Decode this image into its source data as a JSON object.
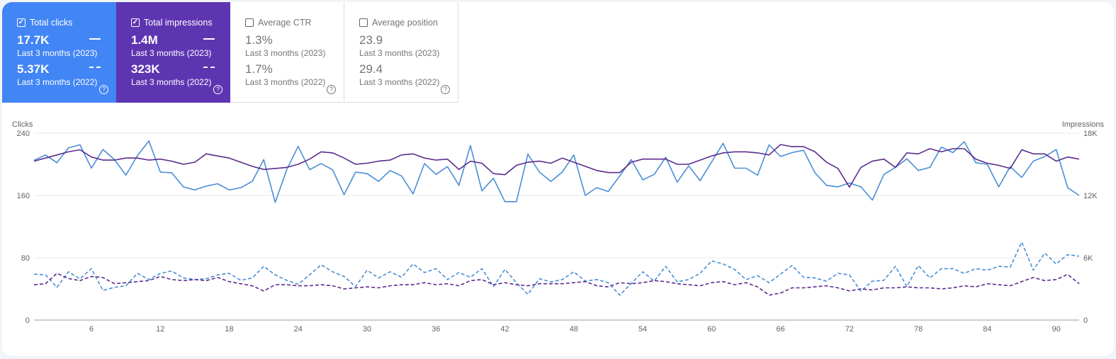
{
  "metrics": [
    {
      "label": "Total clicks",
      "checked": true,
      "value_2023": "17.7K",
      "period_2023": "Last 3 months (2023)",
      "value_2022": "5.37K",
      "period_2022": "Last 3 months (2022)",
      "bg": "#4285f4",
      "fg": "#ffffff"
    },
    {
      "label": "Total impressions",
      "checked": true,
      "value_2023": "1.4M",
      "period_2023": "Last 3 months (2023)",
      "value_2022": "323K",
      "period_2022": "Last 3 months (2022)",
      "bg": "#5e35b1",
      "fg": "#ffffff"
    },
    {
      "label": "Average CTR",
      "checked": false,
      "value_2023": "1.3%",
      "period_2023": "Last 3 months (2023)",
      "value_2022": "1.7%",
      "period_2022": "Last 3 months (2022)",
      "bg": "#ffffff",
      "fg": "#757575"
    },
    {
      "label": "Average position",
      "checked": false,
      "value_2023": "23.9",
      "period_2023": "Last 3 months (2023)",
      "value_2022": "29.4",
      "period_2022": "Last 3 months (2022)",
      "bg": "#ffffff",
      "fg": "#757575"
    }
  ],
  "icons": {
    "checkbox": "checkbox-icon",
    "help": "help-icon"
  },
  "chart_data": {
    "type": "line",
    "ylabel": "Clicks",
    "y2label": "Impressions",
    "ylim": [
      0,
      240
    ],
    "yticks": [
      0,
      80,
      160,
      240
    ],
    "y2lim": [
      0,
      18000
    ],
    "y2ticks": [
      "0",
      "6K",
      "12K",
      "18K"
    ],
    "xlim": [
      1,
      92
    ],
    "xticks": [
      6,
      12,
      18,
      24,
      30,
      36,
      42,
      48,
      54,
      60,
      66,
      72,
      78,
      84,
      90
    ],
    "grid": true,
    "series": [
      {
        "axis": "left",
        "style": "solid",
        "color": "#4a8ed6",
        "values": [
          205,
          212,
          202,
          221,
          225,
          195,
          219,
          206,
          186,
          211,
          230,
          190,
          189,
          171,
          167,
          172,
          175,
          167,
          170,
          178,
          206,
          151,
          193,
          223,
          193,
          201,
          193,
          161,
          190,
          188,
          178,
          192,
          185,
          162,
          201,
          187,
          197,
          173,
          224,
          166,
          182,
          152,
          152,
          213,
          190,
          178,
          190,
          212,
          160,
          170,
          165,
          185,
          206,
          180,
          187,
          209,
          177,
          198,
          179,
          203,
          227,
          195,
          195,
          186,
          225,
          210,
          215,
          218,
          189,
          173,
          171,
          176,
          171,
          154,
          187,
          196,
          207,
          192,
          196,
          222,
          215,
          229,
          202,
          200,
          171,
          197,
          183,
          204,
          210,
          219,
          170,
          160
        ]
      },
      {
        "axis": "right",
        "style": "solid",
        "color": "#5b2c8e",
        "values": [
          15300,
          15600,
          15900,
          16200,
          16400,
          15700,
          15400,
          15400,
          15600,
          15600,
          15400,
          15500,
          15300,
          15000,
          15200,
          16000,
          15800,
          15600,
          15200,
          14800,
          14500,
          14600,
          14700,
          15000,
          15500,
          16200,
          16100,
          15600,
          15000,
          15100,
          15300,
          15400,
          15900,
          16000,
          15600,
          15400,
          15500,
          14500,
          15300,
          15100,
          14100,
          14000,
          14900,
          15200,
          15300,
          15100,
          15600,
          15200,
          14800,
          14400,
          14200,
          14200,
          15200,
          15500,
          15500,
          15500,
          15000,
          15000,
          15400,
          15800,
          16100,
          16200,
          16200,
          16100,
          15900,
          16900,
          16700,
          16700,
          16200,
          15200,
          14600,
          12800,
          14700,
          15300,
          15500,
          14700,
          16100,
          16000,
          16500,
          16200,
          16500,
          16500,
          15500,
          15100,
          14900,
          14600,
          16400,
          16000,
          16000,
          15300,
          15700,
          15500
        ]
      },
      {
        "axis": "left",
        "style": "dashed",
        "color": "#4a8ed6",
        "values": [
          59,
          58,
          42,
          62,
          53,
          66,
          38,
          42,
          44,
          60,
          52,
          60,
          63,
          54,
          52,
          53,
          58,
          60,
          51,
          54,
          69,
          58,
          51,
          46,
          58,
          71,
          62,
          56,
          43,
          64,
          54,
          62,
          55,
          72,
          61,
          66,
          52,
          61,
          55,
          66,
          43,
          65,
          48,
          33,
          53,
          49,
          52,
          62,
          50,
          52,
          48,
          32,
          47,
          62,
          50,
          69,
          49,
          52,
          60,
          76,
          72,
          65,
          52,
          57,
          48,
          59,
          70,
          55,
          54,
          50,
          60,
          58,
          37,
          50,
          51,
          69,
          43,
          70,
          54,
          66,
          66,
          60,
          66,
          64,
          69,
          68,
          100,
          64,
          86,
          72,
          84,
          82
        ]
      },
      {
        "axis": "right",
        "style": "dashed",
        "color": "#5b2c8e",
        "values": [
          3400,
          3500,
          4500,
          4000,
          3800,
          4200,
          4100,
          3500,
          3600,
          3700,
          3800,
          4200,
          3900,
          3800,
          3900,
          3800,
          4100,
          3700,
          3500,
          3300,
          2800,
          3400,
          3400,
          3300,
          3300,
          3400,
          3300,
          3000,
          3100,
          3200,
          3100,
          3300,
          3400,
          3400,
          3600,
          3400,
          3500,
          3300,
          3800,
          3900,
          3400,
          3600,
          3400,
          3300,
          3500,
          3500,
          3500,
          3600,
          3700,
          3300,
          3200,
          3600,
          3500,
          3600,
          3800,
          3700,
          3500,
          3400,
          3300,
          3600,
          3700,
          3400,
          3600,
          3200,
          2400,
          2600,
          3100,
          3100,
          3200,
          3300,
          3100,
          2800,
          3000,
          2900,
          3100,
          3100,
          3200,
          3100,
          3100,
          3000,
          3100,
          3300,
          3200,
          3500,
          3400,
          3300,
          3700,
          4100,
          3800,
          3900,
          4400,
          3500
        ]
      }
    ]
  }
}
